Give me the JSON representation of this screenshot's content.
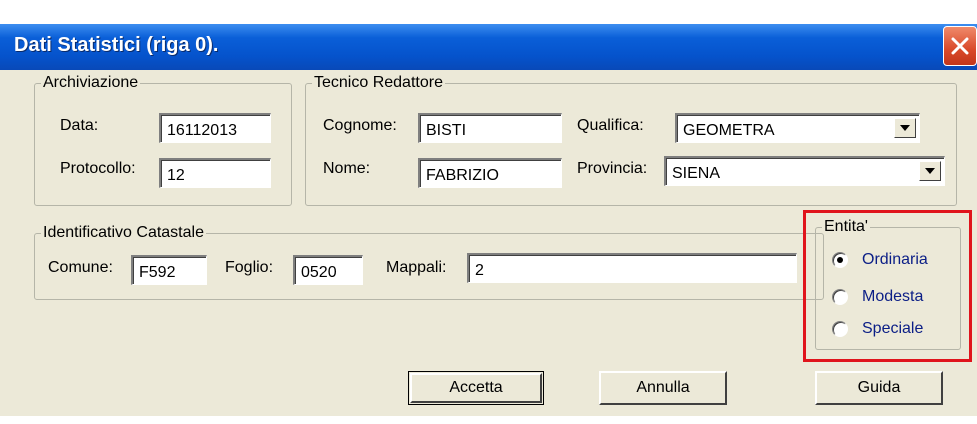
{
  "window": {
    "title": "Dati Statistici  (riga 0).",
    "close_icon": "close-icon"
  },
  "archiviazione": {
    "legend": "Archiviazione",
    "data_label": "Data:",
    "data_value": "16112013",
    "protocollo_label": "Protocollo:",
    "protocollo_value": "12"
  },
  "tecnico": {
    "legend": "Tecnico Redattore",
    "cognome_label": "Cognome:",
    "cognome_value": "BISTI",
    "nome_label": "Nome:",
    "nome_value": "FABRIZIO",
    "qualifica_label": "Qualifica:",
    "qualifica_value": "GEOMETRA",
    "provincia_label": "Provincia:",
    "provincia_value": "SIENA"
  },
  "catastale": {
    "legend": "Identificativo Catastale",
    "comune_label": "Comune:",
    "comune_value": "F592",
    "foglio_label": "Foglio:",
    "foglio_value": "0520",
    "mappali_label": "Mappali:",
    "mappali_value": "2"
  },
  "entita": {
    "legend": "Entita'",
    "options": [
      {
        "label": "Ordinaria",
        "selected": true
      },
      {
        "label": "Modesta",
        "selected": false
      },
      {
        "label": "Speciale",
        "selected": false
      }
    ],
    "highlight_color": "#e0141c"
  },
  "buttons": {
    "accetta": "Accetta",
    "annulla": "Annulla",
    "guida": "Guida"
  },
  "colors": {
    "titlebar": "#0553cc",
    "dialog_bg": "#ece9d8",
    "radio_label": "#0b1e86"
  }
}
